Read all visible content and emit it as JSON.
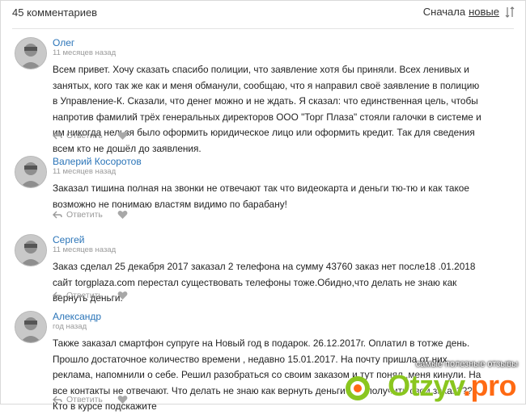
{
  "header": {
    "count": "45 комментариев",
    "sort_label": "Сначала",
    "sort_value": "новые"
  },
  "actions": {
    "reply": "Ответить"
  },
  "comments": [
    {
      "author": "Олег",
      "time": "11 месяцев назад",
      "text": "Всем привет. Хочу сказать спасибо полиции, что заявление хотя бы приняли. Всех ленивых и занятых, кого так же как и меня обманули, сообщаю, что я направил своё заявление в полицию в Управление-К. Сказали, что денег можно и не ждать. Я сказал: что единственная цель, чтобы напротив фамилий трёх генеральных директоров ООО \"Торг Плаза\" стояли галочки в системе и им никогда нельзя было оформить юридическое лицо или оформить кредит. Так для сведения всем кто не дошёл до заявления."
    },
    {
      "author": "Валерий Косоротов",
      "time": "11 месяцев назад",
      "text": "Заказал тишина полная на звонки не отвечают так что видеокарта и деньги тю-тю и как такое возможно не понимаю властям видимо по барабану!"
    },
    {
      "author": "Сергей",
      "time": "11 месяцев назад",
      "text": "Заказ сделал 25 декабря 2017 заказал 2 телефона на сумму 43760 заказ нет после18 .01.2018 сайт torgplaza.com перестал существовать телефоны тоже.Обидно,что делать не знаю как вернуть деньги."
    },
    {
      "author": "Александр",
      "time": "год назад",
      "text": "Также заказал смартфон супруге на Новый год в подарок. 26.12.2017г. Оплатил в тотже день. Прошло достаточное количество времени , недавно 15.01.2017. На почту пришла от них реклама, напомнили о себе. Решил разобраться со своим заказом и тут понял ,меня кинули. На все контакты не отвечают. Что делать не знаю как вернуть деньги или получить свой заказ??? Кто в курсе подскажите"
    }
  ],
  "watermark": {
    "subtitle": "самые полезные отзывы",
    "brand": "Otzyv",
    "dot": ".",
    "tld": "pro"
  },
  "colors": {
    "author_link": "#2a74b8",
    "muted": "#9a9a9a",
    "brand_green": "#8ac61f",
    "brand_orange": "#ff6a13"
  },
  "icons": {
    "sort": "sort-arrows-icon",
    "reply": "reply-arrow-icon",
    "like": "heart-icon",
    "avatar": "default-user-avatar"
  }
}
